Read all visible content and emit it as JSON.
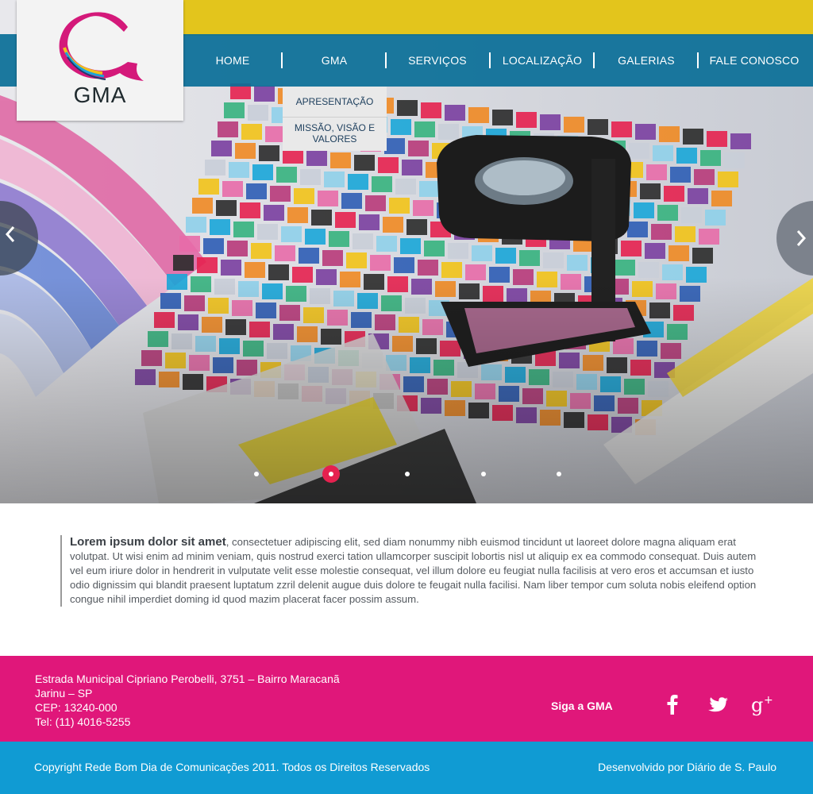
{
  "brand": {
    "logo_text": "GMA",
    "pink": "#e0177a",
    "blue": "#109bd3",
    "nav_blue": "#0b6f98",
    "accent_red": "#e5214f"
  },
  "nav": {
    "items": [
      "HOME",
      "GMA",
      "SERVIÇOS",
      "LOCALIZAÇÃO",
      "GALERIAS",
      "FALE CONOSCO"
    ]
  },
  "dropdown": {
    "parent": "GMA",
    "items": [
      "APRESENTAÇÃO",
      "MISSÃO, VISÃO E VALORES"
    ]
  },
  "slider": {
    "prev_icon": "chevron-left-icon",
    "next_icon": "chevron-right-icon",
    "dot_count": 5,
    "active_index": 1
  },
  "content": {
    "lead": "Lorem ipsum dolor sit amet",
    "body": ", consectetuer adipiscing elit, sed diam nonummy nibh euismod tincidunt ut laoreet dolore magna aliquam erat volutpat. Ut wisi enim ad minim veniam, quis nostrud exerci tation ullamcorper suscipit lobortis nisl ut aliquip ex ea commodo consequat. Duis autem vel eum iriure dolor in hendrerit in vulputate velit esse molestie consequat, vel illum dolore eu feugiat nulla facilisis at vero eros et accumsan et iusto odio dignissim qui blandit praesent luptatum zzril delenit augue duis dolore te feugait nulla facilisi. Nam liber tempor cum soluta nobis eleifend option congue nihil imperdiet doming id quod mazim placerat facer possim assum."
  },
  "footer": {
    "address": [
      "Estrada Municipal Cipriano Perobelli, 3751 – Bairro Maracanã",
      "Jarinu – SP",
      "CEP: 13240-000",
      "Tel: (11) 4016-5255"
    ],
    "follow_label": "Siga a GMA",
    "social_icons": [
      "facebook-icon",
      "twitter-icon",
      "google-plus-icon"
    ],
    "copyright": "Copyright Rede Bom Dia de Comunicações 2011. Todos os  Direitos Reservados",
    "developer": "Desenvolvido por Diário de S. Paulo"
  }
}
